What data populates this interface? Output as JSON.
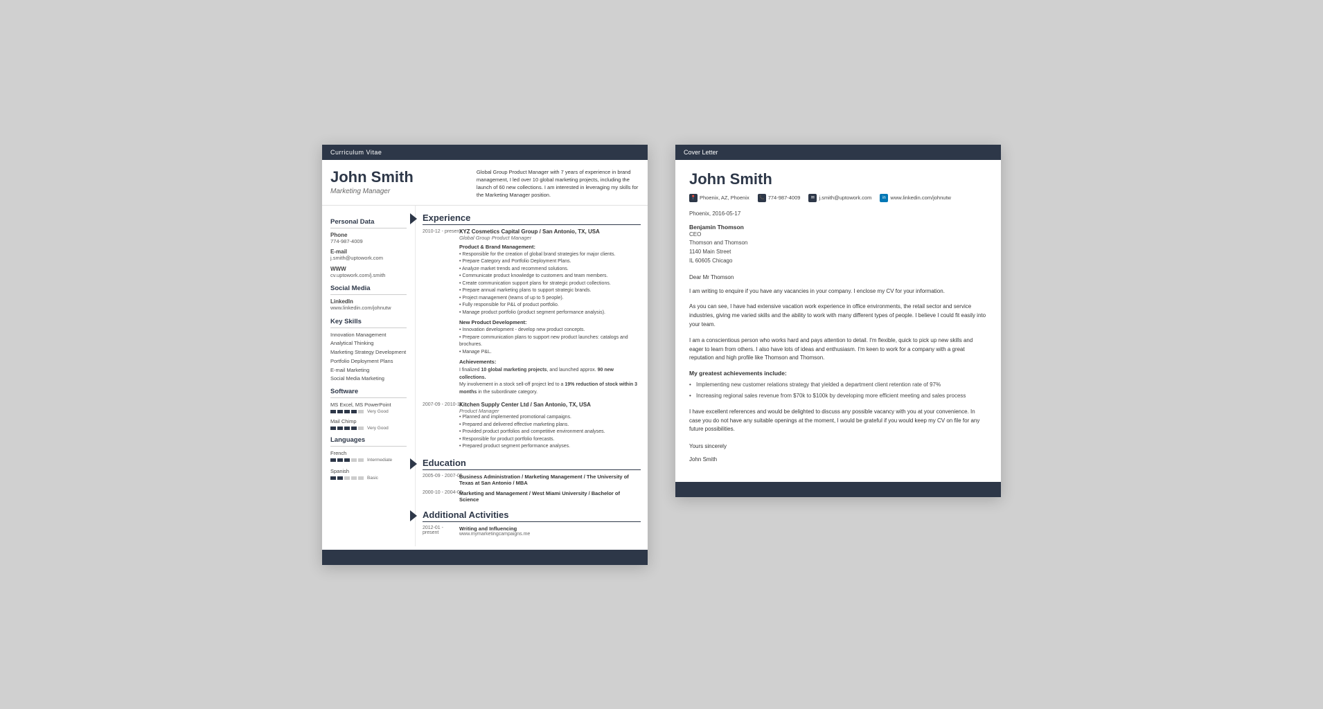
{
  "cv": {
    "header_bar": "Curriculum Vitae",
    "name": "John Smith",
    "title": "Marketing Manager",
    "summary": "Global Group Product Manager with 7 years of experience in brand management, I led over 10 global marketing projects, including the launch of 60 new collections. I am interested in leveraging my skills for the Marketing Manager position.",
    "personal_data": {
      "section_title": "Personal Data",
      "phone_label": "Phone",
      "phone_value": "774-987-4009",
      "email_label": "E-mail",
      "email_value": "j.smith@uptowork.com",
      "www_label": "WWW",
      "www_value": "cv.uptowork.com/j.smith"
    },
    "social_media": {
      "section_title": "Social Media",
      "linkedin_label": "LinkedIn",
      "linkedin_value": "www.linkedin.com/johnutw"
    },
    "key_skills": {
      "section_title": "Key Skills",
      "skills": [
        "Innovation Management",
        "Analytical Thinking",
        "Marketing Strategy Development",
        "Portfolio Deployment Plans",
        "E-mail Marketing",
        "Social Media Marketing"
      ]
    },
    "software": {
      "section_title": "Software",
      "items": [
        {
          "name": "MS Excel, MS PowerPoint",
          "filled": 4,
          "empty": 1,
          "label": "Very Good"
        },
        {
          "name": "Mail Chimp",
          "filled": 4,
          "empty": 1,
          "label": "Very Good"
        }
      ]
    },
    "languages": {
      "section_title": "Languages",
      "items": [
        {
          "name": "French",
          "filled": 3,
          "empty": 2,
          "label": "Intermediate"
        },
        {
          "name": "Spanish",
          "filled": 2,
          "empty": 3,
          "label": "Basic"
        }
      ]
    },
    "experience": {
      "section_title": "Experience",
      "items": [
        {
          "date": "2010-12 - present",
          "company": "XYZ Cosmetics Capital Group / San Antonio, TX, USA",
          "role": "Global Group Product Manager",
          "subsections": [
            {
              "title": "Product & Brand Management:",
              "bullets": [
                "Responsible for the creation of global brand strategies for major clients.",
                "Prepare Category and Portfolio Deployment Plans.",
                "Analyze market trends and recommend solutions.",
                "Communicate product knowledge to customers and team members.",
                "Create communication support plans for strategic product collections.",
                "Prepare annual marketing plans to support strategic brands.",
                "Project management (teams of up to 5 people).",
                "Fully responsible for P&L of product portfolio.",
                "Manage product portfolio (product segment performance analysis)."
              ]
            },
            {
              "title": "New Product Development:",
              "bullets": [
                "Innovation development - develop new product concepts.",
                "Prepare communication plans to support new product launches: catalogs and brochures.",
                "Manage P&L."
              ]
            },
            {
              "title": "Achievements:",
              "achievements": [
                "I finalized 10 global marketing projects, and launched approx. 90 new collections.",
                "My involvement in a stock sell-off project led to a 19% reduction of stock within 3 months in the subordinate category."
              ]
            }
          ]
        },
        {
          "date": "2007-09 - 2010-11",
          "company": "Kitchen Supply Center Ltd / San Antonio, TX, USA",
          "role": "Product Manager",
          "subsections": [
            {
              "title": "",
              "bullets": [
                "Planned and implemented promotional campaigns.",
                "Prepared and delivered effective marketing plans.",
                "Provided product portfolios and competitive environment analyses.",
                "Responsible for product portfolio forecasts.",
                "Prepared product segment performance analyses."
              ]
            }
          ]
        }
      ]
    },
    "education": {
      "section_title": "Education",
      "items": [
        {
          "date": "2005-09 - 2007-05",
          "degree": "Business Administration / Marketing Management / The University of Texas at San Antonio / MBA"
        },
        {
          "date": "2000-10 - 2004-05",
          "degree": "Marketing and Management / West Miami University / Bachelor of Science"
        }
      ]
    },
    "activities": {
      "section_title": "Additional Activities",
      "items": [
        {
          "date": "2012-01 - present",
          "title": "Writing and Influencing",
          "url": "www.mymarketingcampaigns.me"
        }
      ]
    }
  },
  "cover_letter": {
    "header_bar": "Cover Letter",
    "name": "John Smith",
    "contact": {
      "location": "Phoenix, AZ, Phoenix",
      "phone": "774-987-4009",
      "email": "j.smith@uptowork.com",
      "linkedin": "www.linkedin.com/johnutw"
    },
    "date": "Phoenix, 2016-05-17",
    "recipient": {
      "name": "Benjamin Thomson",
      "role": "CEO",
      "company": "Thomson and Thomson",
      "address": "1140 Main Street",
      "city": "IL 60605 Chicago"
    },
    "greeting": "Dear Mr Thomson",
    "paragraphs": [
      "I am writing to enquire if you have any vacancies in your company. I enclose my CV for your information.",
      "As you can see, I have had extensive vacation work experience in office environments, the retail sector and service industries, giving me varied skills and the ability to work with many different types of people. I believe I could fit easily into your team.",
      "I am a conscientious person who works hard and pays attention to detail. I'm flexible, quick to pick up new skills and eager to learn from others. I also have lots of ideas and enthusiasm. I'm keen to work for a company with a great reputation and high profile like Thomson and Thomson."
    ],
    "achievements_title": "My greatest achievements include:",
    "achievements": [
      "Implementing new customer relations strategy that yielded a department client retention rate of 97%",
      "Increasing regional sales revenue from $70k to $100k by developing more efficient meeting and sales process"
    ],
    "closing": "I have excellent references and would be delighted to discuss any possible vacancy with you at your convenience. In case you do not have any suitable openings at the moment, I would be grateful if you would keep my CV on file for any future possibilities.",
    "salutation": "Yours sincerely",
    "signature": "John Smith"
  }
}
